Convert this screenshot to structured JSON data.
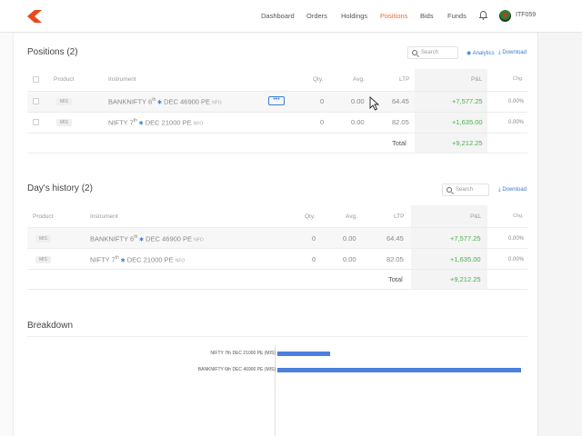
{
  "nav": {
    "items": [
      {
        "label": "Dashboard",
        "active": false
      },
      {
        "label": "Orders",
        "active": false
      },
      {
        "label": "Holdings",
        "active": false
      },
      {
        "label": "Positions",
        "active": true
      },
      {
        "label": "Bids",
        "active": false
      },
      {
        "label": "Funds",
        "active": false
      }
    ],
    "user_id": "ITF059",
    "accent_color": "#ee6a36"
  },
  "positions": {
    "title": "Positions (2)",
    "search_placeholder": "Search",
    "analytics_label": "Analytics",
    "download_label": "Download",
    "headers": {
      "product": "Product",
      "instrument": "Instrument",
      "qty": "Qty.",
      "avg": "Avg.",
      "ltp": "LTP",
      "pnl": "P&L",
      "chg": "Chg."
    },
    "rows": [
      {
        "product": "MIS",
        "inst_name": "BANKNIFTY 6",
        "inst_sup": "th",
        "inst_rest": " DEC 46900 PE",
        "inst_tag": "NFO",
        "qty": "0",
        "avg": "0.00",
        "ltp": "64.45",
        "pnl": "+7,577.25",
        "chg": "0.00%"
      },
      {
        "product": "MIS",
        "inst_name": "NIFTY 7",
        "inst_sup": "th",
        "inst_rest": " DEC 21000 PE",
        "inst_tag": "NFO",
        "qty": "0",
        "avg": "0.00",
        "ltp": "82.05",
        "pnl": "+1,635.00",
        "chg": "0.00%"
      }
    ],
    "total_label": "Total",
    "total_value": "+9,212.25"
  },
  "history": {
    "title": "Day's history (2)",
    "search_placeholder": "Search",
    "download_label": "Download",
    "headers": {
      "product": "Product",
      "instrument": "Instrument",
      "qty": "Qty.",
      "avg": "Avg.",
      "ltp": "LTP",
      "pnl": "P&L",
      "chg": "Chg."
    },
    "rows": [
      {
        "product": "MIS",
        "inst_name": "BANKNIFTY 6",
        "inst_sup": "th",
        "inst_rest": " DEC 46900 PE",
        "inst_tag": "NFO",
        "qty": "0",
        "avg": "0.00",
        "ltp": "64.45",
        "pnl": "+7,577.25",
        "chg": "0.00%"
      },
      {
        "product": "MIS",
        "inst_name": "NIFTY 7",
        "inst_sup": "th",
        "inst_rest": " DEC 21000 PE",
        "inst_tag": "NFO",
        "qty": "0",
        "avg": "0.00",
        "ltp": "82.05",
        "pnl": "+1,635.00",
        "chg": "0.00%"
      }
    ],
    "total_label": "Total",
    "total_value": "+9,212.25"
  },
  "breakdown": {
    "title": "Breakdown",
    "bar_color": "#4a7fdc",
    "bars": [
      {
        "label": "NIFTY 7th DEC 21000 PE (MIS)",
        "value": 1635.0
      },
      {
        "label": "BANKNIFTY 6th DEC 46900 PE (MIS)",
        "value": 7577.25
      }
    ]
  }
}
